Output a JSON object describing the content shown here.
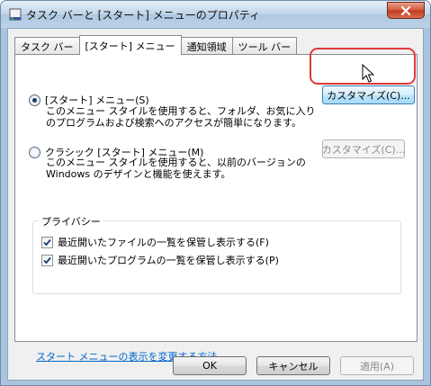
{
  "window": {
    "title": "タスク バーと [スタート] メニューのプロパティ",
    "close_glyph": "✕"
  },
  "tabs": [
    {
      "label": "タスク バー",
      "active": false
    },
    {
      "label": "[スタート] メニュー",
      "active": true
    },
    {
      "label": "通知領域",
      "active": false
    },
    {
      "label": "ツール バー",
      "active": false
    }
  ],
  "start_menu": {
    "option_label": "[スタート] メニュー(S)",
    "description_line1": "このメニュー スタイルを使用すると、フォルダ、お気に入り",
    "description_line2": "のプログラムおよび検索へのアクセスが簡単になります。",
    "customize_label": "カスタマイズ(C)...",
    "selected": true
  },
  "classic_menu": {
    "option_label": "クラシック [スタート] メニュー(M)",
    "description_line1": "このメニュー スタイルを使用すると、以前のバージョンの",
    "description_line2": "Windows のデザインと機能を使えます。",
    "customize_label": "カスタマイズ(C)...",
    "selected": false
  },
  "privacy": {
    "title": "プライバシー",
    "items": [
      {
        "label": "最近開いたファイルの一覧を保管し表示する(F)",
        "checked": true
      },
      {
        "label": "最近開いたプログラムの一覧を保管し表示する(P)",
        "checked": true
      }
    ]
  },
  "help_link": "スタート メニューの表示を変更する方法",
  "buttons": {
    "ok": "OK",
    "cancel": "キャンセル",
    "apply": "適用(A)"
  }
}
